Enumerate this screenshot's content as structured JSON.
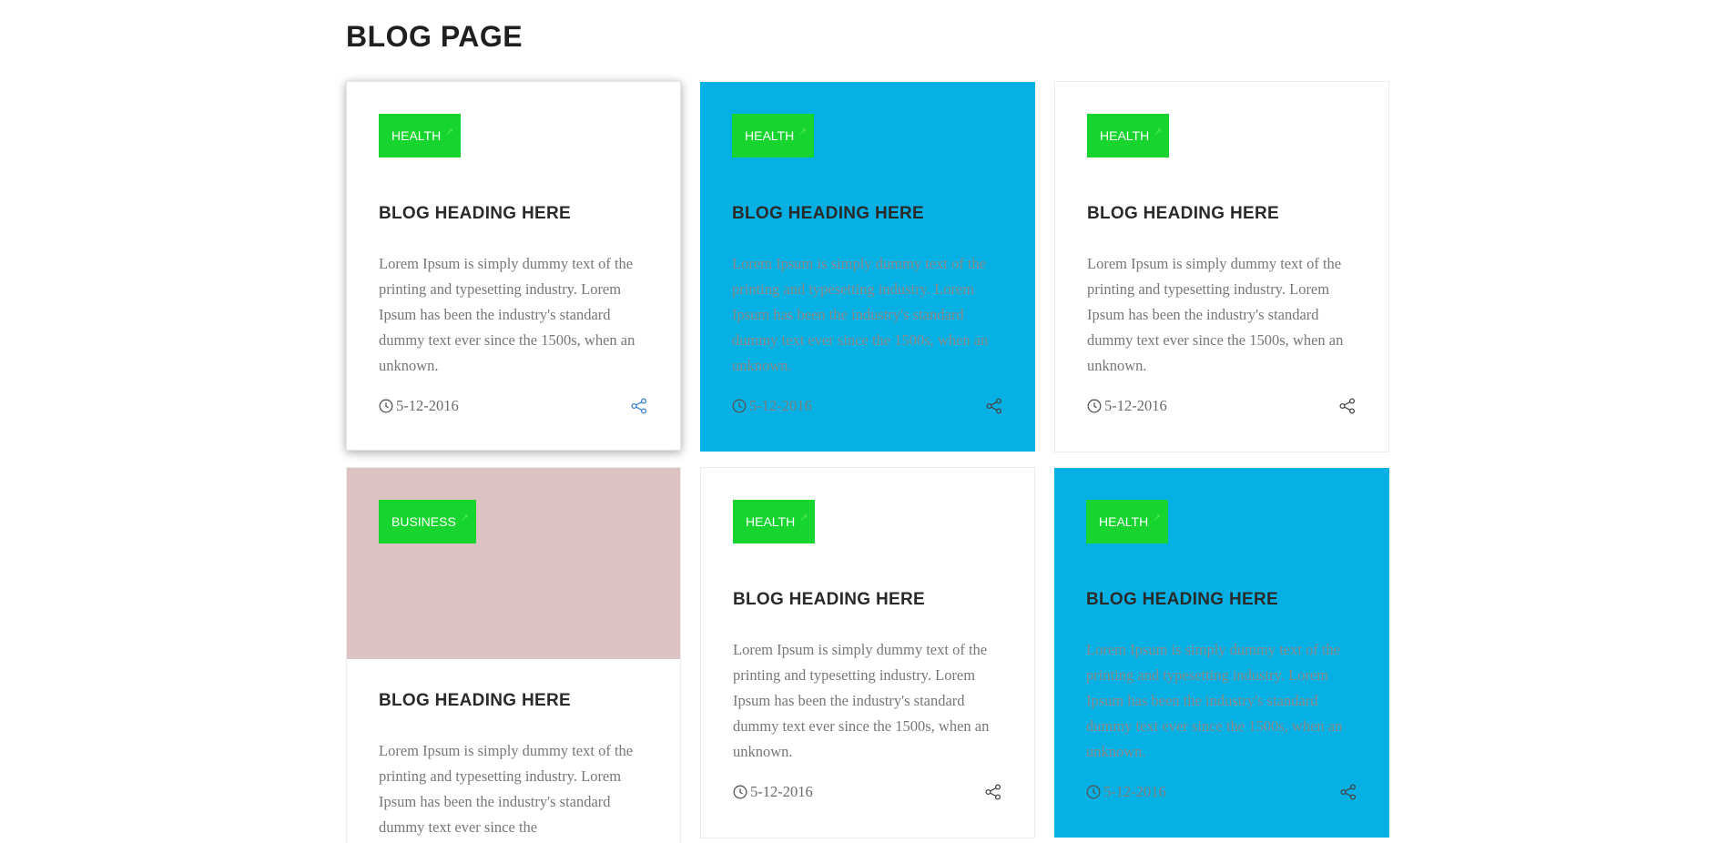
{
  "page": {
    "title": "BLOG PAGE"
  },
  "colors": {
    "tag_green": "#17d42e",
    "card_blue": "#05b1e4",
    "image_placeholder": "#dcc2c3",
    "share_active": "#3b7fd4"
  },
  "cards": [
    {
      "tag": "HEALTH",
      "heading": "BLOG HEADING HERE",
      "text": "Lorem Ipsum is simply dummy text of the printing and typesetting industry. Lorem Ipsum has been the industry's standard dummy text ever since the 1500s, when an unknown.",
      "date": "5-12-2016",
      "date_icon": "clock-icon",
      "share_icon": "share-icon"
    },
    {
      "tag": "HEALTH",
      "heading": "BLOG HEADING HERE",
      "text": "Lorem Ipsum is simply dummy text of the printing and typesetting industry. Lorem Ipsum has been the industry's standard dummy text ever since the 1500s, when an unknown.",
      "date": "5-12-2016",
      "date_icon": "clock-icon",
      "share_icon": "share-icon"
    },
    {
      "tag": "HEALTH",
      "heading": "BLOG HEADING HERE",
      "text": "Lorem Ipsum is simply dummy text of the printing and typesetting industry. Lorem Ipsum has been the industry's standard dummy text ever since the 1500s, when an unknown.",
      "date": "5-12-2016",
      "date_icon": "clock-icon",
      "share_icon": "share-icon"
    },
    {
      "tag": "BUSINESS",
      "heading": "BLOG HEADING HERE",
      "text": "Lorem Ipsum is simply dummy text of the printing and typesetting industry. Lorem Ipsum has been the industry's standard dummy text ever since the"
    },
    {
      "tag": "HEALTH",
      "heading": "BLOG HEADING HERE",
      "text": "Lorem Ipsum is simply dummy text of the printing and typesetting industry. Lorem Ipsum has been the industry's standard dummy text ever since the 1500s, when an unknown.",
      "date": "5-12-2016",
      "date_icon": "clock-icon",
      "share_icon": "share-icon"
    },
    {
      "tag": "HEALTH",
      "heading": "BLOG HEADING HERE",
      "text": "Lorem Ipsum is simply dummy text of the printing and typesetting industry. Lorem Ipsum has been the industry's standard dummy text ever since the 1500s, when an unknown.",
      "date": "5-12-2016",
      "date_icon": "clock-icon",
      "share_icon": "share-icon"
    }
  ]
}
